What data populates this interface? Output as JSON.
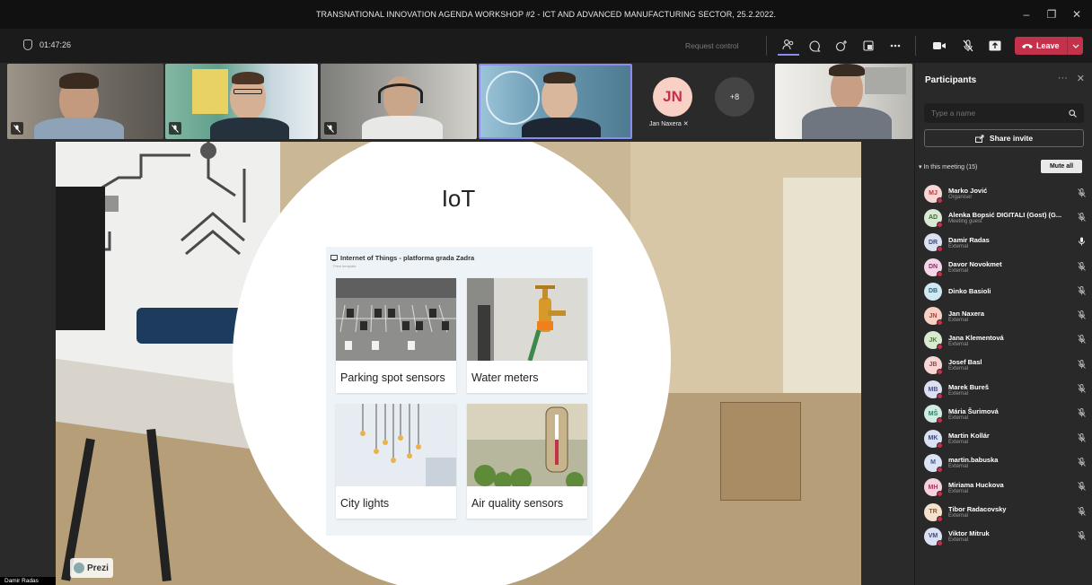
{
  "window": {
    "title": "TRANSNATIONAL INNOVATION AGENDA WORKSHOP #2 - ICT AND ADVANCED MANUFACTURING SECTOR, 25.2.2022.",
    "minimize": "–",
    "restore": "❐",
    "close": "✕"
  },
  "toolbar": {
    "timer": "01:47:26",
    "request_control": "Request control",
    "leave_label": "Leave",
    "icons": [
      "people-icon",
      "chat-icon",
      "reactions-icon",
      "rooms-icon",
      "more-icon",
      "camera-icon",
      "mic-muted-icon",
      "share-icon"
    ]
  },
  "stage": {
    "tiles": [
      {
        "name": "participant-video-1",
        "muted": true
      },
      {
        "name": "participant-video-2",
        "muted": true
      },
      {
        "name": "participant-video-3",
        "muted": true
      },
      {
        "name": "participant-video-4",
        "muted": false
      },
      {
        "name": "participant-video-5",
        "muted": false
      }
    ],
    "avatar_initials": "JN",
    "avatar_name": "Jan Naxera",
    "overflow_count": "+8",
    "presenter_name": "Damir Radas",
    "prezi_label": "Prezi"
  },
  "slide": {
    "title": "IoT",
    "panel_title": "Internet of Things - platforma grada Zadra",
    "panel_subtitle": "Prezi template",
    "cards": [
      {
        "caption": "Parking spot sensors"
      },
      {
        "caption": "Water meters"
      },
      {
        "caption": "City lights"
      },
      {
        "caption": "Air quality sensors"
      }
    ]
  },
  "participants": {
    "title": "Participants",
    "search_placeholder": "Type a name",
    "share_invite": "Share invite",
    "in_meeting": "In this meeting (15)",
    "mute_all": "Mute all",
    "list": [
      {
        "initials": "MJ",
        "name": "Marko Jović",
        "role": "Organiser",
        "color": "#f8d6d6",
        "fg": "#b43b3b",
        "mic": "muted"
      },
      {
        "initials": "AD",
        "name": "Alenka Bopsić DIGITALI (Gost) (G...",
        "role": "Meeting guest",
        "color": "#d8ead4",
        "fg": "#3b6b32",
        "mic": "muted"
      },
      {
        "initials": "DR",
        "name": "Damir Radas",
        "role": "External",
        "color": "#dbe1f2",
        "fg": "#3a4a7a",
        "mic": "on"
      },
      {
        "initials": "DN",
        "name": "Davor Novokmet",
        "role": "External",
        "color": "#f3d7e8",
        "fg": "#8a2f66",
        "mic": "muted"
      },
      {
        "initials": "DB",
        "name": "Dinko Basioli",
        "role": "",
        "color": "#cfe8f2",
        "fg": "#1c6a85",
        "mic": "muted"
      },
      {
        "initials": "JN",
        "name": "Jan Naxera",
        "role": "External",
        "color": "#f8d0c4",
        "fg": "#c4314b",
        "mic": "muted"
      },
      {
        "initials": "JK",
        "name": "Jana Klementová",
        "role": "External",
        "color": "#d9ead2",
        "fg": "#4c7a3a",
        "mic": "muted"
      },
      {
        "initials": "JB",
        "name": "Josef Basl",
        "role": "External",
        "color": "#f8d6d6",
        "fg": "#b43b3b",
        "mic": "muted"
      },
      {
        "initials": "MB",
        "name": "Marek Bureš",
        "role": "External",
        "color": "#dde0f2",
        "fg": "#4a4f8a",
        "mic": "muted"
      },
      {
        "initials": "MŠ",
        "name": "Mária Šurimová",
        "role": "External",
        "color": "#d2ece3",
        "fg": "#2e7a5d",
        "mic": "muted"
      },
      {
        "initials": "MK",
        "name": "Martin Kollár",
        "role": "External",
        "color": "#dbe1f2",
        "fg": "#3a4a7a",
        "mic": "muted"
      },
      {
        "initials": "M",
        "name": "martin.babuska",
        "role": "External",
        "color": "#dce4f4",
        "fg": "#3f5a8a",
        "mic": "muted"
      },
      {
        "initials": "MH",
        "name": "Miriama Huckova",
        "role": "External",
        "color": "#f6d3dc",
        "fg": "#a3385a",
        "mic": "muted"
      },
      {
        "initials": "TR",
        "name": "Tibor Radacovsky",
        "role": "External",
        "color": "#f4e2cf",
        "fg": "#8a5a2e",
        "mic": "muted"
      },
      {
        "initials": "VM",
        "name": "Viktor Mitruk",
        "role": "External",
        "color": "#dbe1f2",
        "fg": "#3a4a7a",
        "mic": "muted"
      }
    ]
  }
}
